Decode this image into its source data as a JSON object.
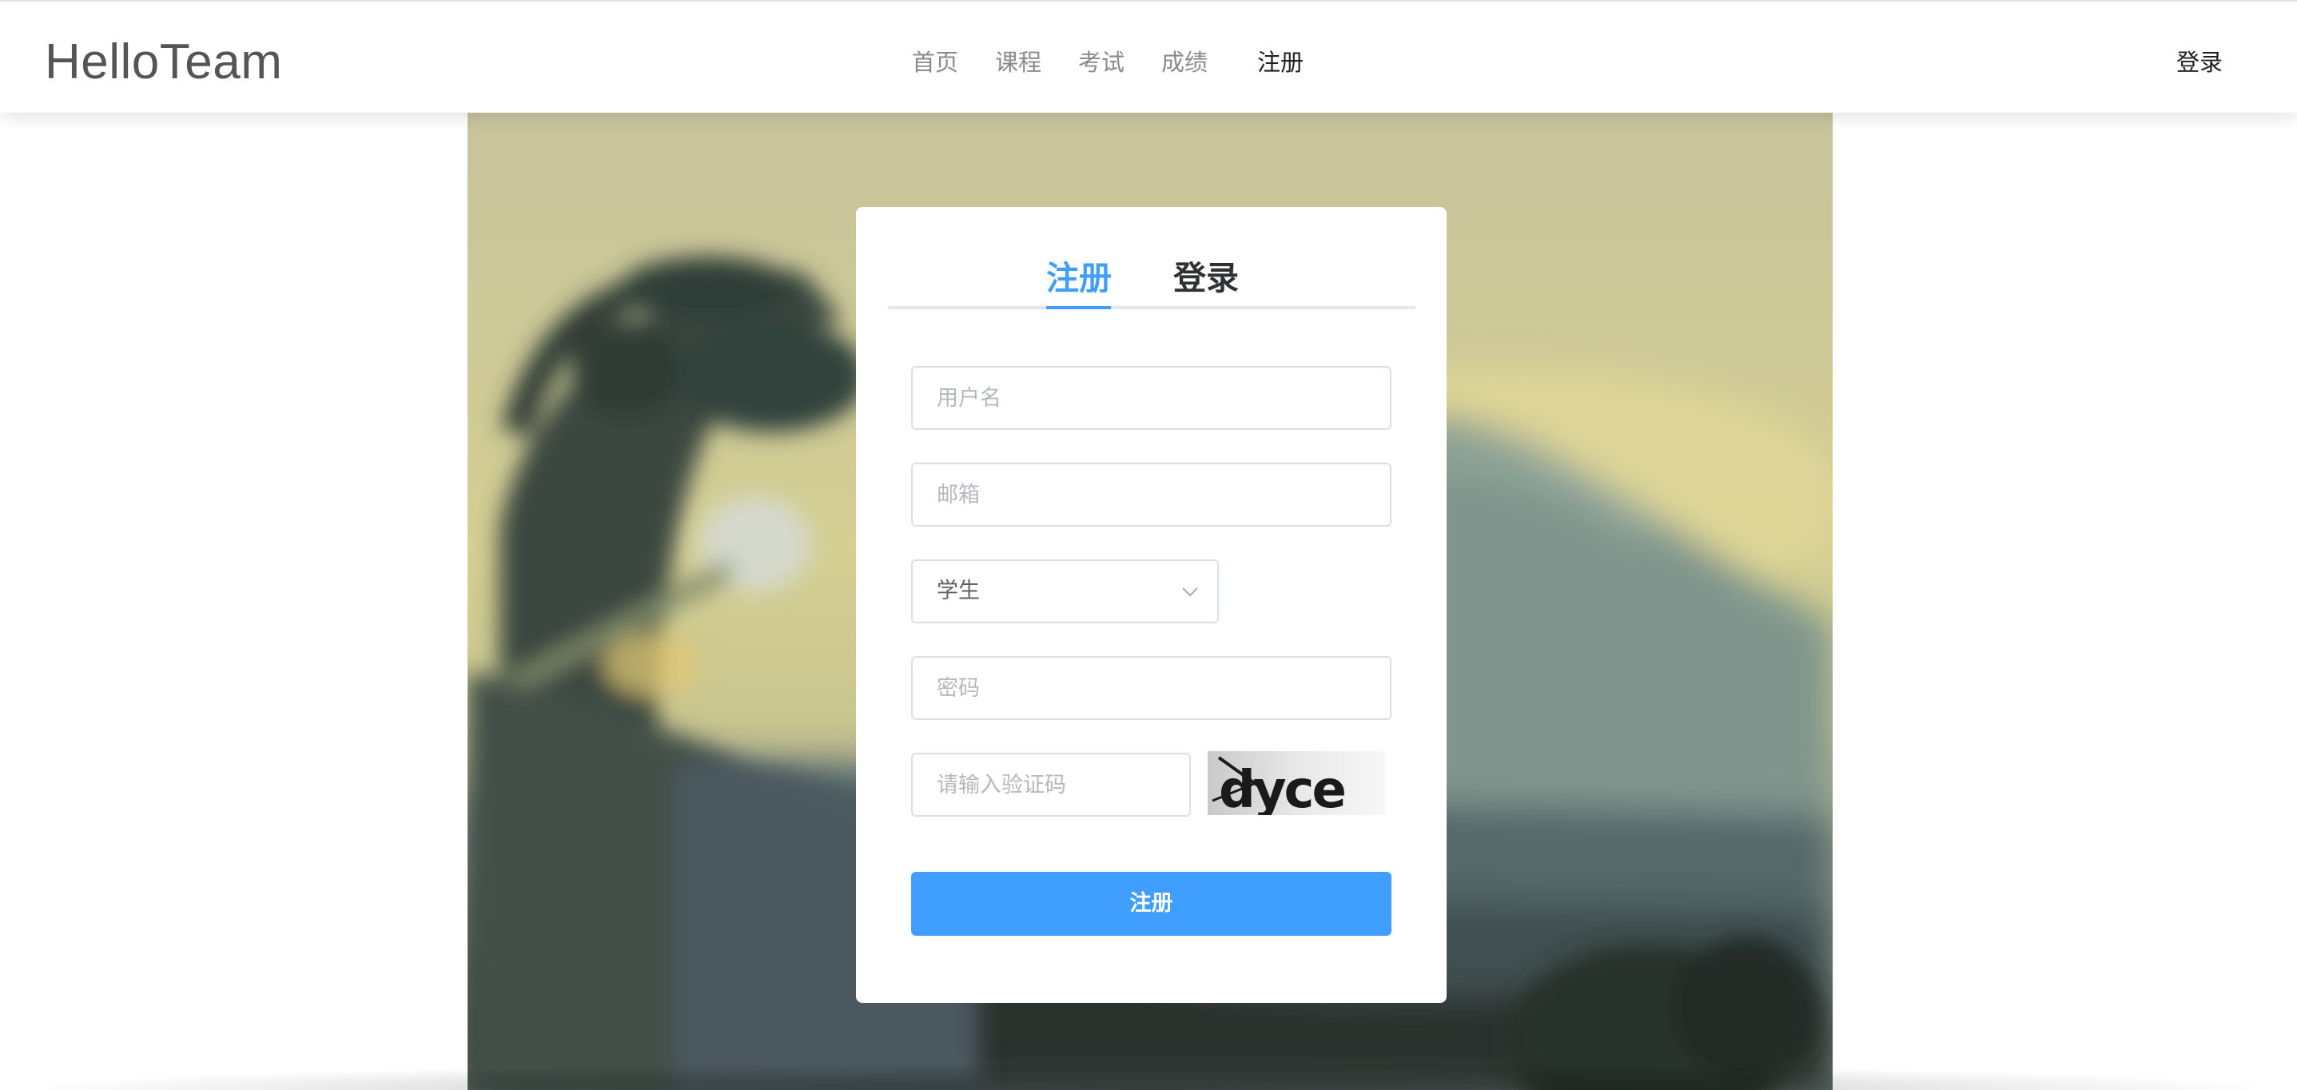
{
  "brand": {
    "logo_text": "HelloTeam"
  },
  "nav": {
    "home": "首页",
    "courses": "课程",
    "exams": "考试",
    "grades": "成绩",
    "register": "注册",
    "login": "登录"
  },
  "card": {
    "tabs": {
      "register": "注册",
      "login": "登录",
      "active": "register"
    },
    "username_placeholder": "用户名",
    "email_placeholder": "邮箱",
    "role_value": "学生",
    "password_placeholder": "密码",
    "captcha_placeholder": "请输入验证码",
    "captcha_text": "dyce",
    "submit_label": "注册"
  },
  "colors": {
    "accent": "#409eff",
    "logo": "#555555",
    "nav_muted": "#8a8a8a",
    "nav_strong": "#1f1f1f"
  },
  "icons": {
    "select_arrow": "chevron-down-icon"
  }
}
